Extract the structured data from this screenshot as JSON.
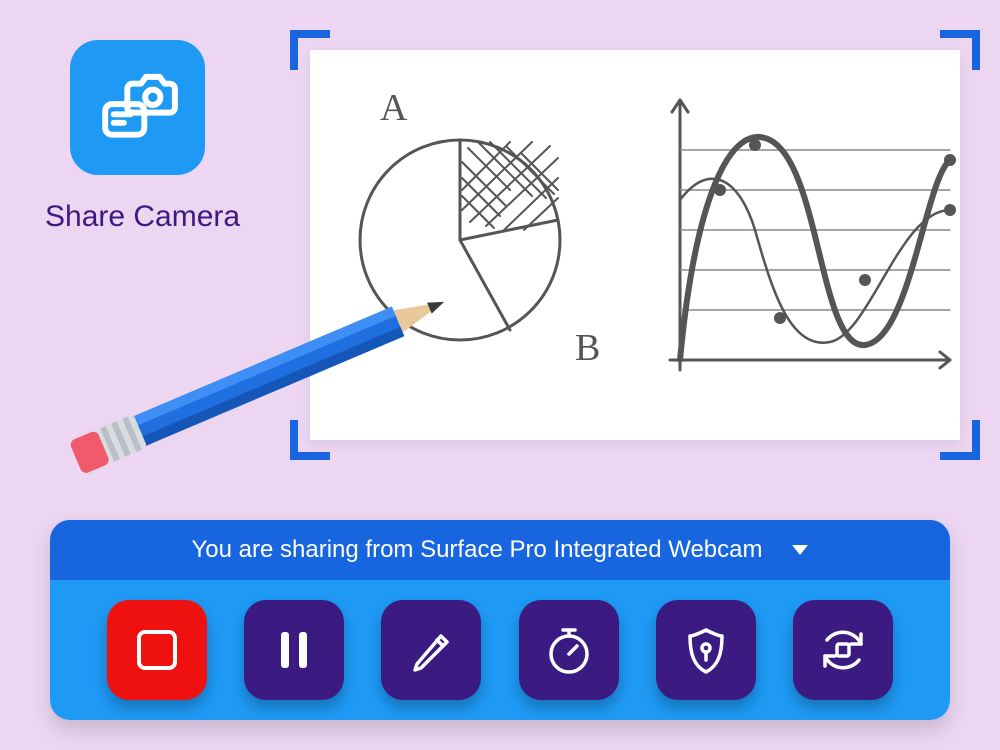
{
  "feature": {
    "label": "Share Camera"
  },
  "preview": {
    "sketch_labels": {
      "a": "A",
      "b": "B"
    }
  },
  "status": {
    "text": "You are sharing from Surface Pro Integrated Webcam"
  },
  "tools": {
    "stop": {
      "name": "stop-button"
    },
    "pause": {
      "name": "pause-button"
    },
    "draw": {
      "name": "annotate-button"
    },
    "timer": {
      "name": "stopwatch-button"
    },
    "shield": {
      "name": "privacy-button"
    },
    "switch": {
      "name": "switch-camera-button"
    }
  },
  "colors": {
    "bg": "#ecd6f2",
    "accent_blue": "#1e9af5",
    "deep_blue": "#1865e0",
    "purple_dark": "#3b1a82",
    "stop_red": "#ef1010"
  }
}
